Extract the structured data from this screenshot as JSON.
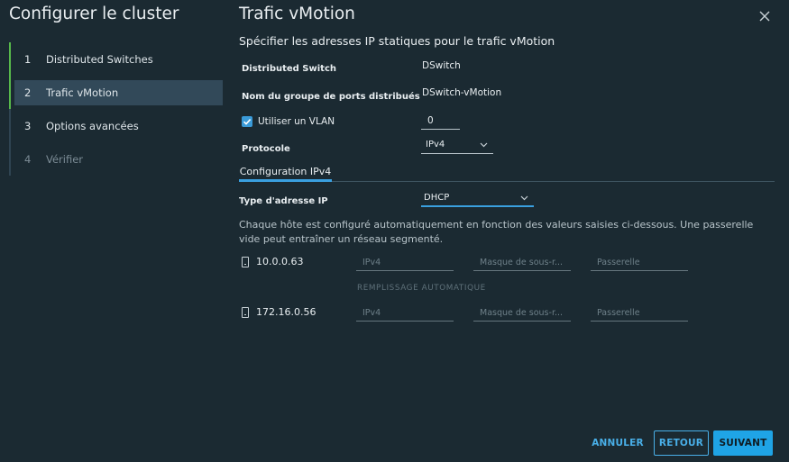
{
  "wizard": {
    "title": "Configurer le cluster",
    "steps": [
      {
        "num": "1",
        "label": "Distributed Switches"
      },
      {
        "num": "2",
        "label": "Trafic vMotion"
      },
      {
        "num": "3",
        "label": "Options avancées"
      },
      {
        "num": "4",
        "label": "Vérifier"
      }
    ]
  },
  "page": {
    "title": "Trafic vMotion",
    "subtitle": "Spécifier les adresses IP statiques pour le trafic vMotion"
  },
  "form": {
    "distributed_switch_label": "Distributed Switch",
    "distributed_switch_value": "DSwitch",
    "port_group_label": "Nom du groupe de ports distribués",
    "port_group_value": "DSwitch-vMotion",
    "vlan_label": "Utiliser un VLAN",
    "vlan_checked": true,
    "vlan_value": "0",
    "protocol_label": "Protocole",
    "protocol_value": "IPv4",
    "tab_label": "Configuration IPv4",
    "ip_type_label": "Type d'adresse IP",
    "ip_type_value": "DHCP",
    "description": "Chaque hôte est configuré automatiquement en fonction des valeurs saisies ci-dessous. Une passerelle vide peut entraîner un réseau segmenté.",
    "autofill_label": "REMPLISSAGE AUTOMATIQUE"
  },
  "hosts": [
    {
      "name": "10.0.0.63",
      "ipv4_placeholder": "IPv4",
      "mask_placeholder": "Masque de sous-r...",
      "gateway_placeholder": "Passerelle"
    },
    {
      "name": "172.16.0.56",
      "ipv4_placeholder": "IPv4",
      "mask_placeholder": "Masque de sous-r...",
      "gateway_placeholder": "Passerelle"
    }
  ],
  "buttons": {
    "cancel": "ANNULER",
    "back": "RETOUR",
    "next": "SUIVANT"
  },
  "colors": {
    "background": "#1b2a32",
    "accent": "#1fa4e6",
    "progress_done": "#57b94b",
    "active_step": "#324959"
  }
}
